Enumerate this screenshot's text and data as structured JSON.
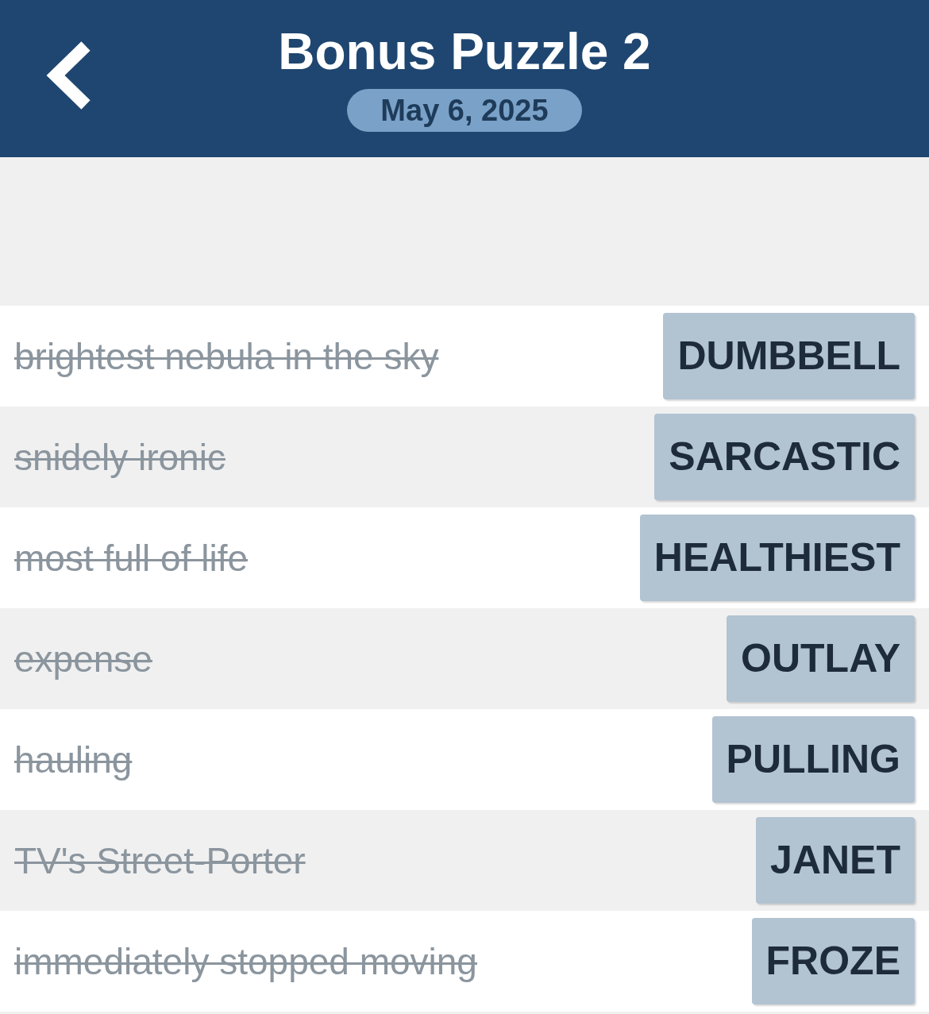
{
  "header": {
    "title": "Bonus Puzzle 2",
    "date": "May 6, 2025"
  },
  "clues": [
    {
      "clue": "brightest nebula in the sky",
      "answer": "DUMBBELL",
      "solved": true
    },
    {
      "clue": "snidely ironic",
      "answer": "SARCASTIC",
      "solved": true
    },
    {
      "clue": "most full of life",
      "answer": "HEALTHIEST",
      "solved": true
    },
    {
      "clue": "expense",
      "answer": "OUTLAY",
      "solved": true
    },
    {
      "clue": "hauling",
      "answer": "PULLING",
      "solved": true
    },
    {
      "clue": "TV's Street-Porter",
      "answer": "JANET",
      "solved": true
    },
    {
      "clue": "immediately stopped moving",
      "answer": "FROZE",
      "solved": true
    }
  ]
}
